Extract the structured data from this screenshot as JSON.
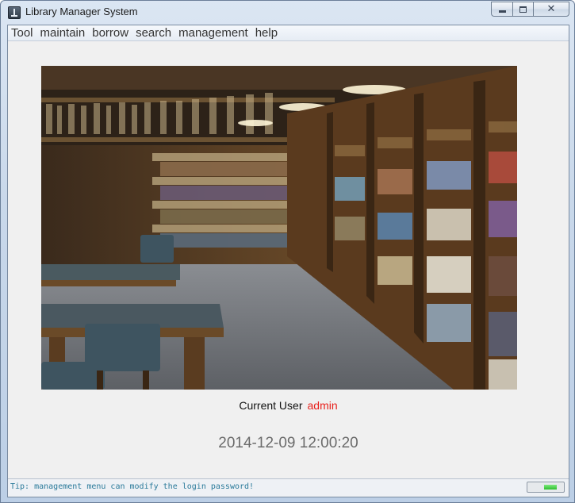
{
  "window": {
    "title": "Library Manager System"
  },
  "menu": [
    "Tool",
    "maintain",
    "borrow",
    "search",
    "management",
    "help"
  ],
  "main": {
    "current_user_label": "Current User",
    "current_user_value": "admin",
    "datetime": "2014-12-09 12:00:20"
  },
  "status": {
    "tip": "Tip: management menu can modify the login password!",
    "progress_fraction": 0.35
  },
  "colors": {
    "user_value": "#e8201b",
    "tip_text": "#2a7a9a"
  },
  "icons": {
    "app": "app-icon",
    "minimize": "minimize-icon",
    "maximize": "maximize-icon",
    "close": "close-icon"
  }
}
